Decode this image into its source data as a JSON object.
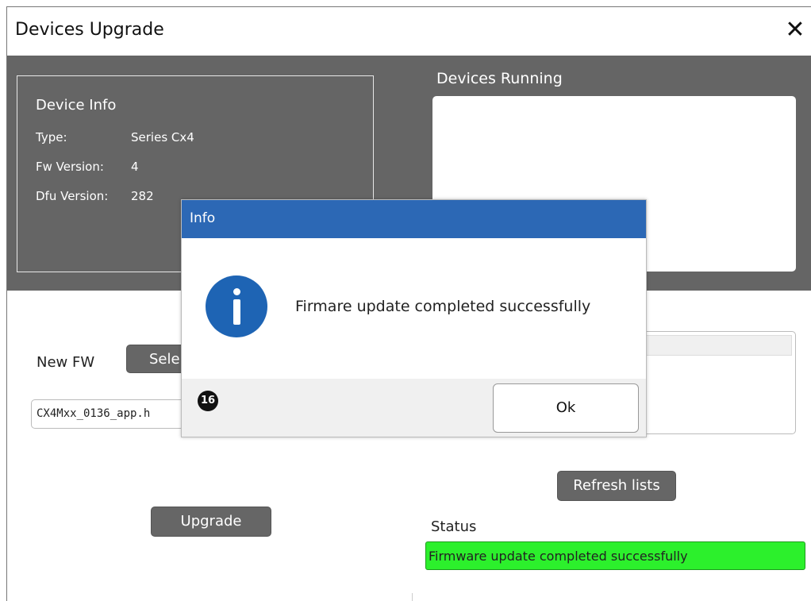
{
  "window": {
    "title": "Devices Upgrade",
    "close_glyph": "✕"
  },
  "device_info": {
    "title": "Device Info",
    "rows": [
      {
        "label": "Type:",
        "value": "Series Cx4"
      },
      {
        "label": "Fw Version:",
        "value": "4"
      },
      {
        "label": "Dfu Version:",
        "value": "282"
      }
    ]
  },
  "devices_running": {
    "title": "Devices Running"
  },
  "new_fw": {
    "label": "New FW",
    "select_button": "Sele",
    "file_value": "CX4Mxx_0136_app.h"
  },
  "buttons": {
    "refresh": "Refresh lists",
    "upgrade": "Upgrade"
  },
  "status": {
    "label": "Status",
    "text": "Firmware update completed successfully",
    "color": "#2cf02c"
  },
  "modal": {
    "title": "Info",
    "icon": "info-icon",
    "message": "Firmare update completed successfully",
    "ok_label": "Ok",
    "header_color": "#2c68b5"
  },
  "step_badge": "16"
}
